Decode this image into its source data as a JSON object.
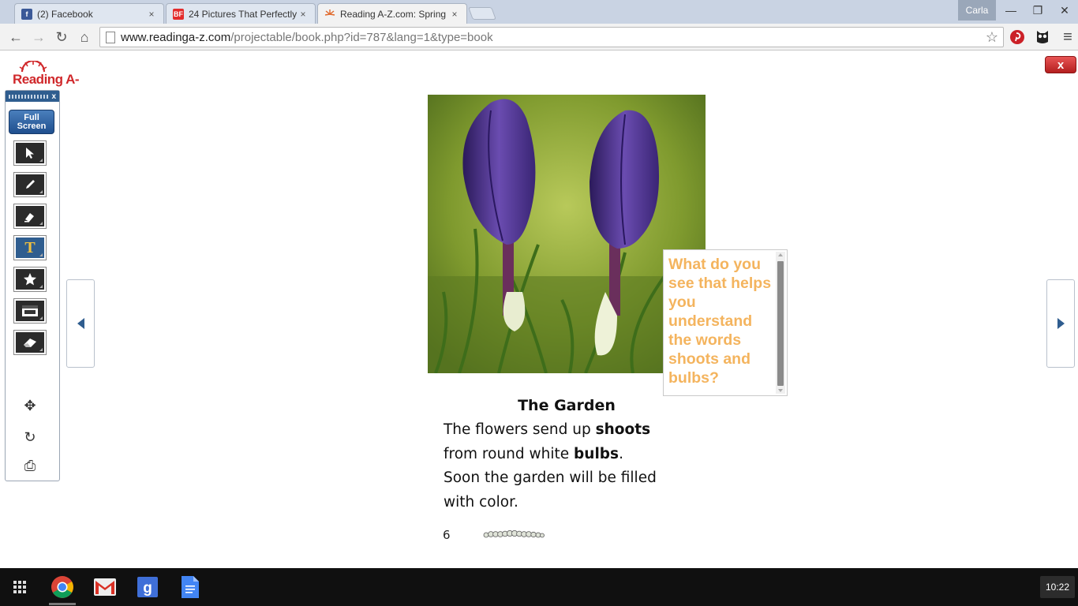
{
  "tabs": [
    {
      "label": "(2) Facebook",
      "favicon": "facebook-icon",
      "fav_text": "f",
      "fav_color": "#3b5998",
      "close": "×"
    },
    {
      "label": "24 Pictures That Perfectly",
      "favicon": "buzzfeed-icon",
      "fav_text": "BF",
      "fav_color": "#e32c2c",
      "close": "×"
    },
    {
      "label": "Reading A-Z.com: Spring",
      "favicon": "reading-az-icon",
      "fav_text": "",
      "fav_color": "#e0682a",
      "close": "×"
    }
  ],
  "profile": {
    "name": "Carla"
  },
  "window": {
    "minimize": "—",
    "restore": "❐",
    "close": "✕"
  },
  "toolbar": {
    "back": "←",
    "forward": "→",
    "reload": "↻",
    "home": "⌂",
    "url_host": "www.readinga-z.com",
    "url_path": "/projectable/book.php?id=787&lang=1&type=book",
    "bookmark": "☆",
    "menu": "≡"
  },
  "app": {
    "logo_text": "Reading A-Z",
    "exit_label": "x",
    "palette": {
      "close": "x",
      "fullscreen_line1": "Full",
      "fullscreen_line2": "Screen",
      "tools": [
        "select-tool",
        "pencil-tool",
        "highlighter-tool",
        "text-tool",
        "stamp-tool",
        "mask-tool",
        "eraser-tool"
      ],
      "text_tool_label": "T",
      "move": "✥",
      "refresh": "↻",
      "print": "⎙"
    },
    "question": "What do you see that helps you understand the words shoots and bulbs?",
    "story": {
      "title": "The Garden",
      "line1_pre": "The flowers send up ",
      "line1_bold": "shoots",
      "line2_pre": "from round white ",
      "line2_bold": "bulbs",
      "line2_post": ".",
      "line3": "Soon the garden will be filled",
      "line4": "with color."
    },
    "page_number": "6"
  },
  "taskbar": {
    "apps": [
      "app-launcher-icon",
      "chrome-icon",
      "gmail-icon",
      "google-search-icon",
      "google-docs-icon"
    ],
    "clock": "10:22"
  },
  "colors": {
    "accent": "#2f5d8f",
    "question_text": "#f4b45e",
    "logo_red": "#d0282b"
  }
}
